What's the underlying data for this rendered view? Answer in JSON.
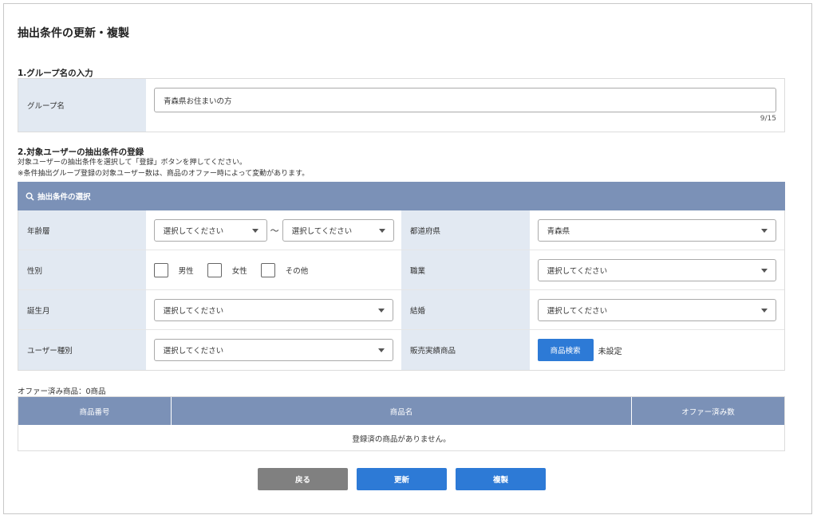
{
  "page": {
    "title": "抽出条件の更新・複製"
  },
  "section1": {
    "title": "1.グループ名の入力",
    "label": "グループ名",
    "input_value": "青森県お住まいの方",
    "char_count": "9/15"
  },
  "section2": {
    "title": "2.対象ユーザーの抽出条件の登録",
    "note1": "対象ユーザーの抽出条件を選択して「登録」ボタンを押してください。",
    "note2": "※条件抽出グループ登録の対象ユーザー数は、商品のオファー時によって変動があります。"
  },
  "conditions": {
    "header": "抽出条件の選択",
    "age_label": "年齢層",
    "age_from": "選択してください",
    "age_sep": "〜",
    "age_to": "選択してください",
    "pref_label": "都道府県",
    "pref_value": "青森県",
    "gender_label": "性別",
    "gender_options": [
      "男性",
      "女性",
      "その他"
    ],
    "job_label": "職業",
    "job_value": "選択してください",
    "birth_label": "誕生月",
    "birth_value": "選択してください",
    "marriage_label": "結婚",
    "marriage_value": "選択してください",
    "usertype_label": "ユーザー種別",
    "usertype_value": "選択してください",
    "sales_label": "販売実績商品",
    "sales_button": "商品検索",
    "sales_status": "未設定"
  },
  "offer": {
    "count_text": "オファー済み商品：0商品",
    "columns": [
      "商品番号",
      "商品名",
      "オファー済み数"
    ],
    "empty_text": "登録済の商品がありません。"
  },
  "buttons": {
    "back": "戻る",
    "update": "更新",
    "copy": "複製"
  },
  "colors": {
    "header_bg": "#7b91b7",
    "label_bg": "#e2e9f2",
    "primary": "#2d7ad6",
    "secondary": "#808080"
  }
}
